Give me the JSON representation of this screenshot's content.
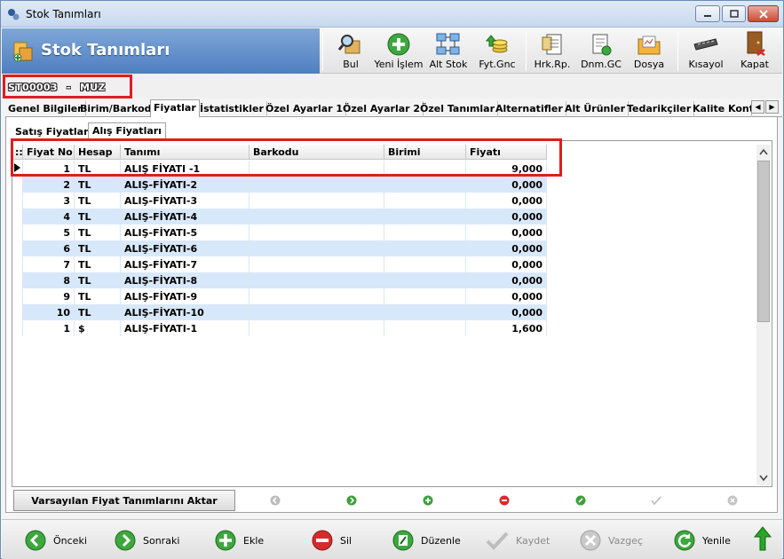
{
  "window": {
    "title": "Stok Tanımları"
  },
  "header": {
    "banner_title": "Stok Tanımları",
    "toolbar": [
      {
        "label": "Bul",
        "icon": "search-box-icon"
      },
      {
        "label": "Yeni İşlem",
        "icon": "add-icon"
      },
      {
        "label": "Alt Stok",
        "icon": "network-icon"
      },
      {
        "label": "Fyt.Gnc",
        "icon": "price-update-icon"
      },
      {
        "label": "Hrk.Rp.",
        "icon": "report-icon"
      },
      {
        "label": "Dnm.GC",
        "icon": "document-icon"
      },
      {
        "label": "Dosya",
        "icon": "file-icon"
      },
      {
        "label": "Kısayol",
        "icon": "keyboard-icon"
      },
      {
        "label": "Kapat",
        "icon": "door-exit-icon"
      }
    ]
  },
  "stock": {
    "code": "ST00003",
    "separator": "-",
    "name": "MUZ"
  },
  "tabs": [
    "Genel Bilgiler",
    "Birim/Barkod",
    "Fiyatlar",
    "İstatistikler",
    "Özel Ayarlar 1",
    "Özel Ayarlar 2",
    "Özel Tanımlar",
    "Alternatifler",
    "Alt Ürünler",
    "Tedarikçiler",
    "Kalite Kontr"
  ],
  "subtabs": [
    "Satış Fiyatları",
    "Alış Fiyatları"
  ],
  "grid": {
    "columns": [
      "Fiyat No",
      "Hesap",
      "Tanımı",
      "Barkodu",
      "Birimi",
      "Fiyatı"
    ],
    "rows": [
      {
        "no": "1",
        "hesap": "TL",
        "tanim": "ALIŞ FİYATI -1",
        "barkod": "",
        "birim": "",
        "fiyat": "9,000"
      },
      {
        "no": "2",
        "hesap": "TL",
        "tanim": "ALIŞ-FİYATI-2",
        "barkod": "",
        "birim": "",
        "fiyat": "0,000"
      },
      {
        "no": "3",
        "hesap": "TL",
        "tanim": "ALIŞ-FİYATI-3",
        "barkod": "",
        "birim": "",
        "fiyat": "0,000"
      },
      {
        "no": "4",
        "hesap": "TL",
        "tanim": "ALIŞ-FİYATI-4",
        "barkod": "",
        "birim": "",
        "fiyat": "0,000"
      },
      {
        "no": "5",
        "hesap": "TL",
        "tanim": "ALIŞ-FİYATI-5",
        "barkod": "",
        "birim": "",
        "fiyat": "0,000"
      },
      {
        "no": "6",
        "hesap": "TL",
        "tanim": "ALIŞ-FİYATI-6",
        "barkod": "",
        "birim": "",
        "fiyat": "0,000"
      },
      {
        "no": "7",
        "hesap": "TL",
        "tanim": "ALIŞ-FİYATI-7",
        "barkod": "",
        "birim": "",
        "fiyat": "0,000"
      },
      {
        "no": "8",
        "hesap": "TL",
        "tanim": "ALIŞ-FİYATI-8",
        "barkod": "",
        "birim": "",
        "fiyat": "0,000"
      },
      {
        "no": "9",
        "hesap": "TL",
        "tanim": "ALIŞ-FİYATI-9",
        "barkod": "",
        "birim": "",
        "fiyat": "0,000"
      },
      {
        "no": "10",
        "hesap": "TL",
        "tanim": "ALIŞ-FİYATI-10",
        "barkod": "",
        "birim": "",
        "fiyat": "0,000"
      },
      {
        "no": "1",
        "hesap": "$",
        "tanim": "ALIŞ-FİYATI-1",
        "barkod": "",
        "birim": "",
        "fiyat": "1,600"
      }
    ]
  },
  "grid_toolbar": {
    "aktar_label": "Varsayılan Fiyat Tanımlarını Aktar"
  },
  "footer": {
    "onceki": "Önceki",
    "sonraki": "Sonraki",
    "ekle": "Ekle",
    "sil": "Sil",
    "duzenle": "Düzenle",
    "kaydet": "Kaydet",
    "vazgec": "Vazgeç",
    "yenile": "Yenile"
  },
  "colors": {
    "accent_blue": "#4e7fc0",
    "highlight_red": "#e21b23",
    "row_alt": "#d8e8fb"
  }
}
